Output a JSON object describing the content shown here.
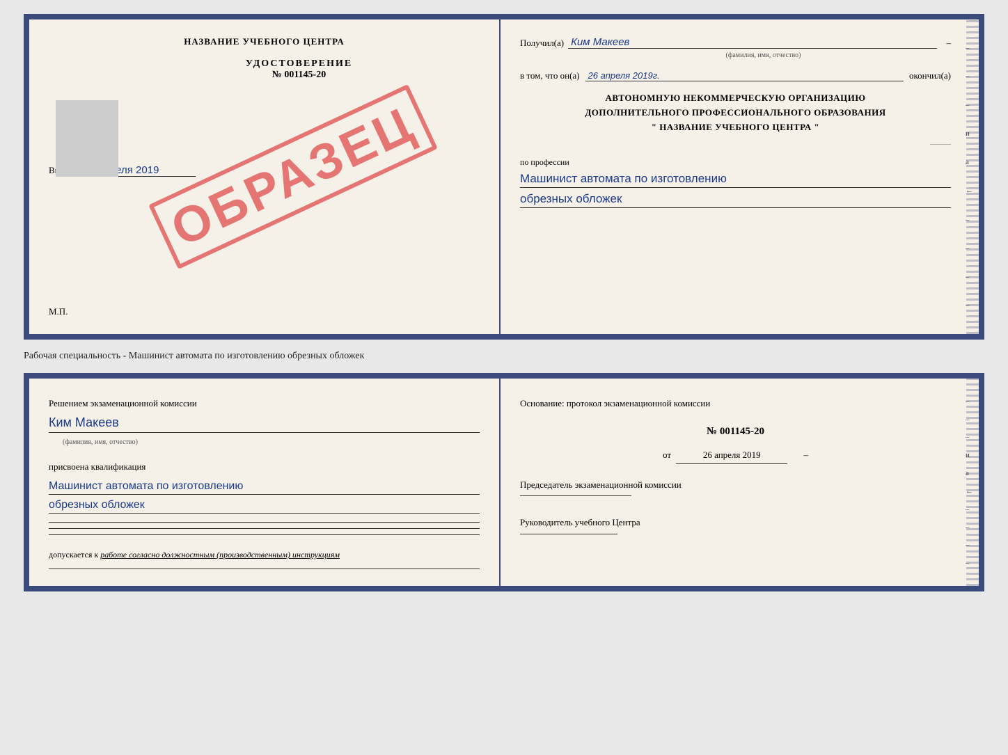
{
  "topDoc": {
    "left": {
      "centerTitle": "НАЗВАНИЕ УЧЕБНОГО ЦЕНТРА",
      "certLabel": "УДОСТОВЕРЕНИЕ",
      "certNumber": "№ 001145-20",
      "issuedText": "Выдано",
      "issuedDate": "26 апреля 2019",
      "mpLabel": "М.П.",
      "watermark": "ОБРАЗЕЦ"
    },
    "right": {
      "receivedLabel": "Получил(а)",
      "receivedName": "Ким Макеев",
      "nameHint": "(фамилия, имя, отчество)",
      "inThatLabel": "в том, что он(а)",
      "inThatDate": "26 апреля 2019г.",
      "finishedLabel": "окончил(а)",
      "orgBlock1": "АВТОНОМНУЮ НЕКОММЕРЧЕСКУЮ ОРГАНИЗАЦИЮ",
      "orgBlock2": "ДОПОЛНИТЕЛЬНОГО ПРОФЕССИОНАЛЬНОГО ОБРАЗОВАНИЯ",
      "orgBlock3": "\" НАЗВАНИЕ УЧЕБНОГО ЦЕНТРА \"",
      "professionLabel": "по профессии",
      "professionLine1": "Машинист автомата по изготовлению",
      "professionLine2": "обрезных обложек",
      "dashChars": [
        "–",
        "–",
        "–",
        "и",
        "а",
        "←",
        "–",
        "–",
        "–",
        "–"
      ]
    }
  },
  "descriptionLine": "Рабочая специальность - Машинист автомата по изготовлению обрезных обложек",
  "bottomDoc": {
    "left": {
      "decisionLabel": "Решением экзаменационной комиссии",
      "nameValue": "Ким Макеев",
      "nameHint": "(фамилия, имя, отчество)",
      "assignedLabel": "присвоена квалификация",
      "qualLine1": "Машинист автомата по изготовлению",
      "qualLine2": "обрезных обложек",
      "additionalLines": [
        "",
        "",
        ""
      ],
      "allowedLabel": "допускается к",
      "allowedText": "работе согласно должностным (производственным) инструкциям"
    },
    "right": {
      "basisLabel": "Основание: протокол экзаменационной комиссии",
      "protocolNumber": "№  001145-20",
      "datePrefix": "от",
      "dateValue": "26 апреля 2019",
      "chairLabel": "Председатель экзаменационной комиссии",
      "headLabel": "Руководитель учебного Центра",
      "dashChars": [
        "–",
        "–",
        "–",
        "и",
        "а",
        "←",
        "–",
        "–",
        "–",
        "–"
      ]
    }
  }
}
